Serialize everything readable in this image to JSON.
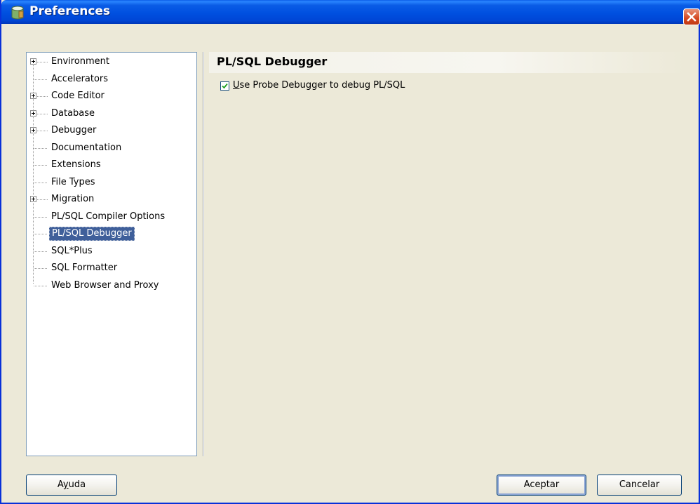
{
  "window": {
    "title": "Preferences"
  },
  "tree": {
    "items": [
      {
        "label": "Environment",
        "expandable": true,
        "selected": false
      },
      {
        "label": "Accelerators",
        "expandable": false,
        "selected": false
      },
      {
        "label": "Code Editor",
        "expandable": true,
        "selected": false
      },
      {
        "label": "Database",
        "expandable": true,
        "selected": false
      },
      {
        "label": "Debugger",
        "expandable": true,
        "selected": false
      },
      {
        "label": "Documentation",
        "expandable": false,
        "selected": false
      },
      {
        "label": "Extensions",
        "expandable": false,
        "selected": false
      },
      {
        "label": "File Types",
        "expandable": false,
        "selected": false
      },
      {
        "label": "Migration",
        "expandable": true,
        "selected": false
      },
      {
        "label": "PL/SQL Compiler Options",
        "expandable": false,
        "selected": false
      },
      {
        "label": "PL/SQL Debugger",
        "expandable": false,
        "selected": true
      },
      {
        "label": "SQL*Plus",
        "expandable": false,
        "selected": false
      },
      {
        "label": "SQL Formatter",
        "expandable": false,
        "selected": false
      },
      {
        "label": "Web Browser and Proxy",
        "expandable": false,
        "selected": false
      }
    ]
  },
  "panel": {
    "title": "PL/SQL Debugger",
    "checkbox": {
      "label_mnemonic": "U",
      "label_rest": "se Probe Debugger to debug PL/SQL",
      "checked": true
    }
  },
  "buttons": {
    "help_pre": "A",
    "help_mnemonic": "y",
    "help_post": "uda",
    "ok": "Aceptar",
    "cancel": "Cancelar"
  },
  "colors": {
    "titlebar": "#0050e0",
    "selection": "#3f5f9a",
    "dialog_bg": "#ece9d8"
  }
}
